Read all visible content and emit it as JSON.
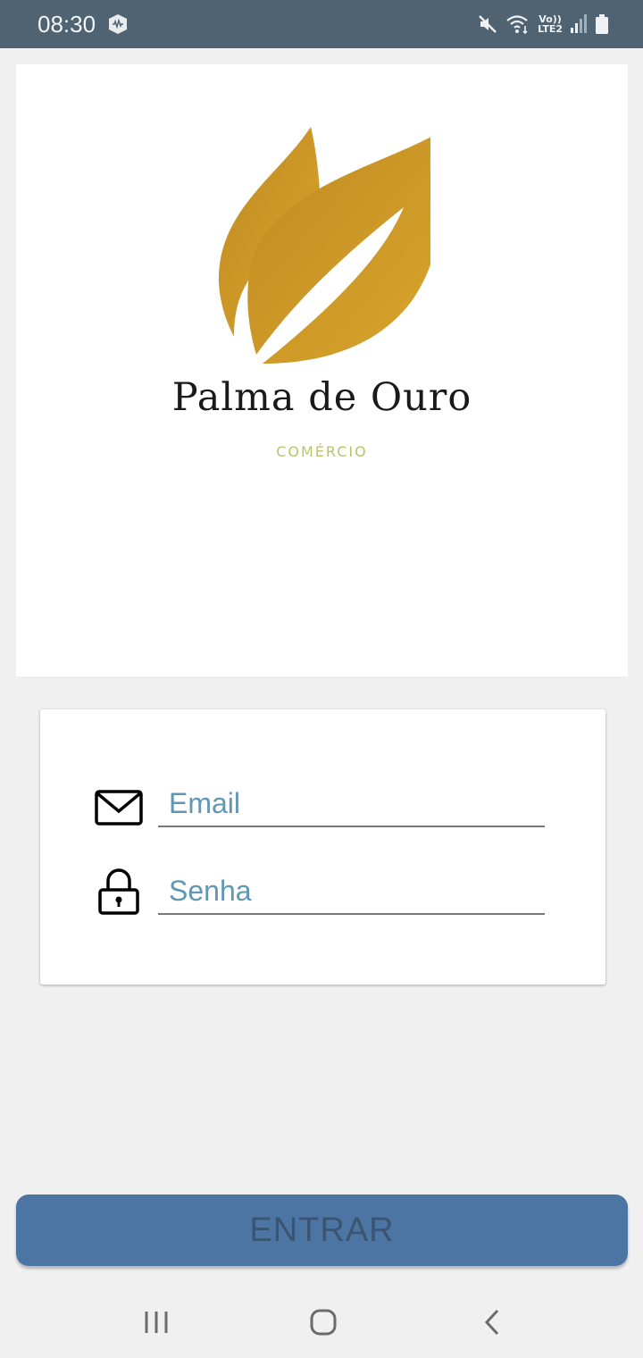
{
  "status_bar": {
    "time": "08:30",
    "lte_top": "Vo))",
    "lte_bottom": "LTE2",
    "icons": [
      "app-shield-icon",
      "mute-icon",
      "wifi-icon",
      "signal-icon",
      "battery-icon"
    ]
  },
  "logo": {
    "brand_name": "Palma de Ouro",
    "subtitle": "COMÉRCIO",
    "icon": "golden-leaf-icon",
    "leaf_color": "#d4a22a"
  },
  "login": {
    "email_placeholder": "Email",
    "password_placeholder": "Senha",
    "email_icon": "envelope-icon",
    "password_icon": "lock-icon"
  },
  "actions": {
    "enter_label": "ENTRAR",
    "button_color": "#4d75a3"
  },
  "nav": {
    "recent_icon": "recent-apps-icon",
    "home_icon": "home-icon",
    "back_icon": "back-icon"
  }
}
